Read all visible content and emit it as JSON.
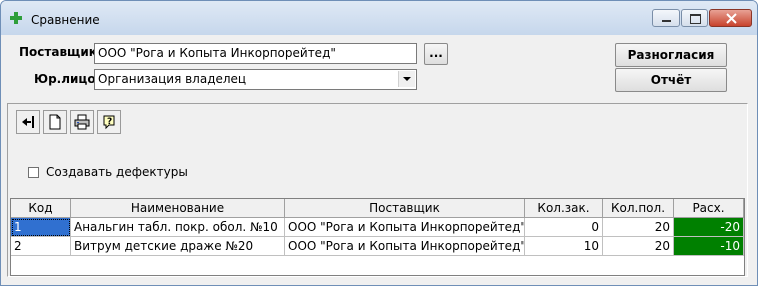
{
  "window": {
    "title": "Сравнение"
  },
  "form": {
    "supplier_label": "Поставщик",
    "supplier_value": "ООО \"Рога и Копыта Инкорпорейтед\"",
    "browse_label": "...",
    "entity_label": "Юр.лицо",
    "entity_value": "Организация владелец"
  },
  "buttons": {
    "discrepancies": "Разногласия",
    "report": "Отчёт"
  },
  "toolbar": {
    "icons": [
      "exit-arrow-icon",
      "new-document-icon",
      "print-icon",
      "help-icon"
    ]
  },
  "options": {
    "create_shortages_label": "Создавать дефектуры",
    "create_shortages_checked": false
  },
  "table": {
    "columns": [
      "Код",
      "Наименование",
      "Поставщик",
      "Кол.зак.",
      "Кол.пол.",
      "Расх."
    ],
    "rows": [
      [
        "1",
        "Анальгин табл. покр. обол. №10",
        "ООО \"Рога и Копыта Инкорпорейтед\"",
        "0",
        "20",
        "-20"
      ],
      [
        "2",
        "Витрум детские драже №20",
        "ООО \"Рога и Копыта Инкорпорейтед\"",
        "10",
        "20",
        "-10"
      ]
    ]
  },
  "colors": {
    "negative_cell": "#008000",
    "title_gradient": "#c6d7ec"
  }
}
